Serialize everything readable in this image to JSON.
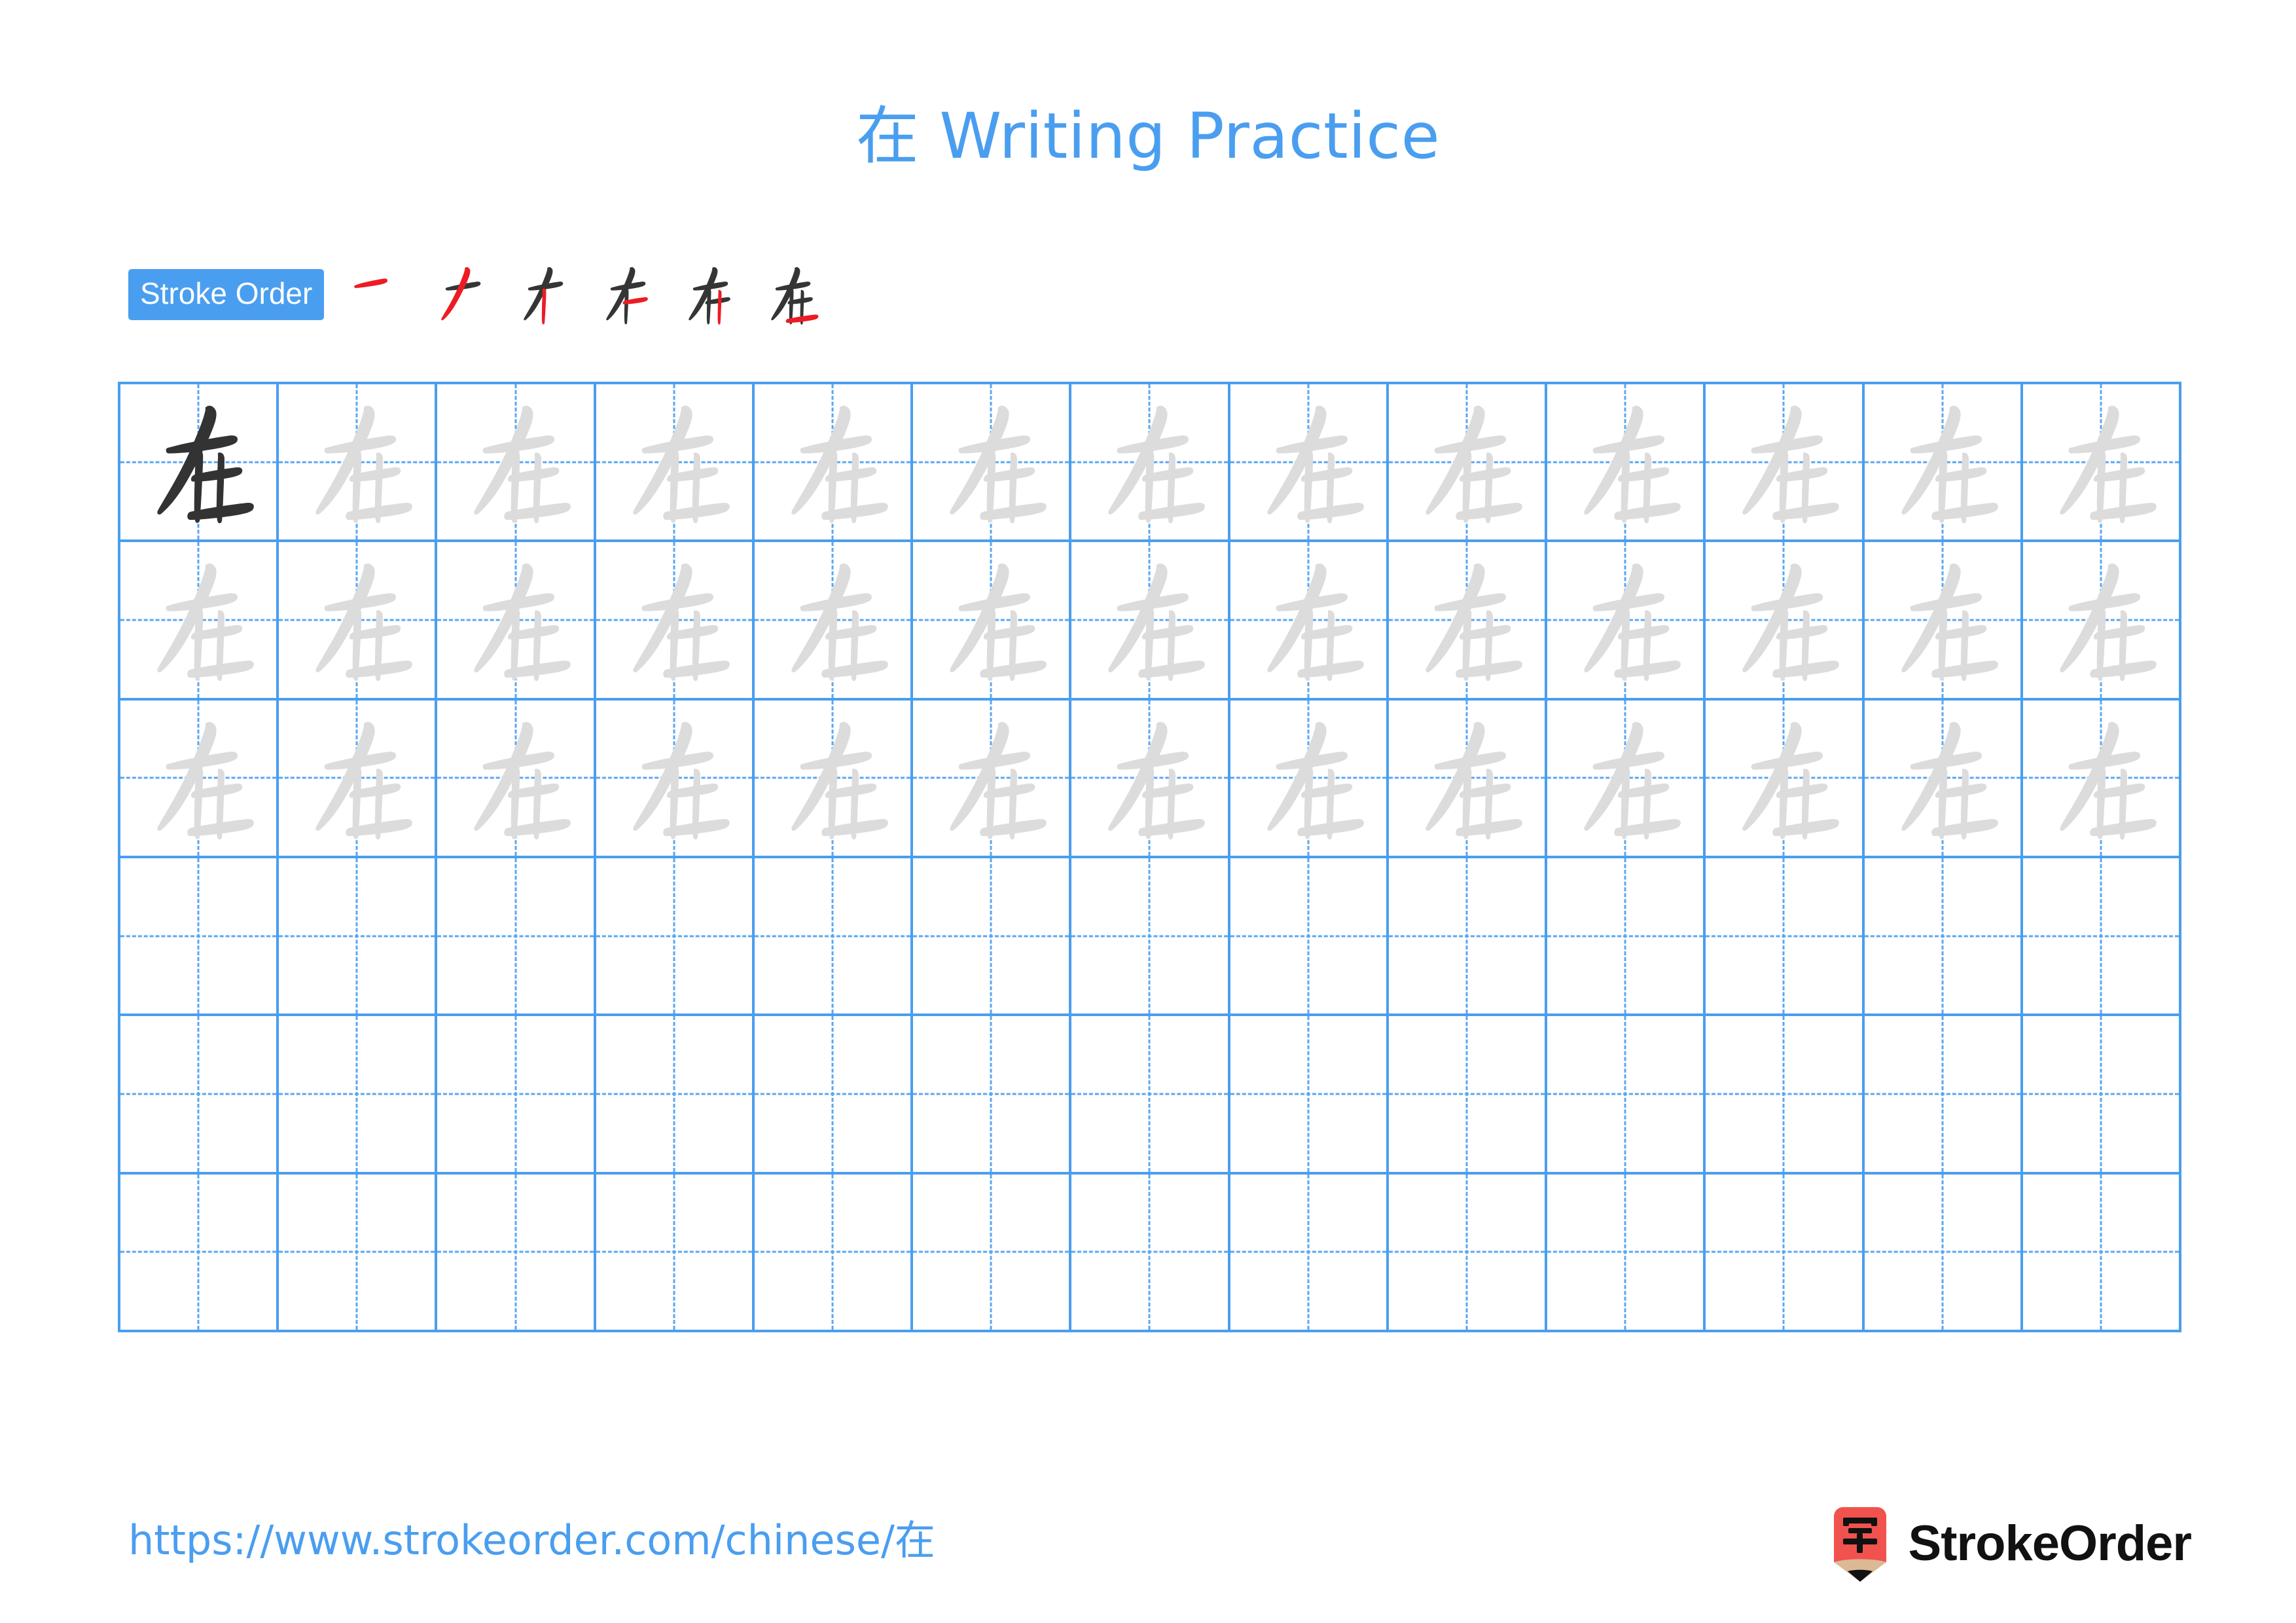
{
  "document": {
    "character": "在",
    "title": "在 Writing Practice",
    "title_color": "#4a9eef",
    "background_color": "#ffffff"
  },
  "stroke_order": {
    "badge_label": "Stroke Order",
    "badge_background": "#4a9eef",
    "badge_text_color": "#ffffff",
    "stroke_count": 6,
    "previous_stroke_color": "#353535",
    "new_stroke_color": "#ed1c24",
    "steps": [
      {
        "index": 1,
        "name": "stroke-step-1",
        "strokes_shown": 1,
        "new_stroke": "héng (horizontal)"
      },
      {
        "index": 2,
        "name": "stroke-step-2",
        "strokes_shown": 2,
        "new_stroke": "piě (left-falling)"
      },
      {
        "index": 3,
        "name": "stroke-step-3",
        "strokes_shown": 3,
        "new_stroke": "shù (vertical)"
      },
      {
        "index": 4,
        "name": "stroke-step-4",
        "strokes_shown": 4,
        "new_stroke": "héng (horizontal)"
      },
      {
        "index": 5,
        "name": "stroke-step-5",
        "strokes_shown": 5,
        "new_stroke": "shù (vertical)"
      },
      {
        "index": 6,
        "name": "stroke-step-6",
        "strokes_shown": 6,
        "new_stroke": "héng (bottom horizontal)"
      }
    ]
  },
  "practice_grid": {
    "columns": 13,
    "rows": 6,
    "grid_line_color": "#4a9eef",
    "guide_line_color": "#5aa7f0",
    "model_character_color": "#333333",
    "trace_character_color": "#dcdcdc",
    "cells": [
      [
        "model",
        "trace",
        "trace",
        "trace",
        "trace",
        "trace",
        "trace",
        "trace",
        "trace",
        "trace",
        "trace",
        "trace",
        "trace"
      ],
      [
        "trace",
        "trace",
        "trace",
        "trace",
        "trace",
        "trace",
        "trace",
        "trace",
        "trace",
        "trace",
        "trace",
        "trace",
        "trace"
      ],
      [
        "trace",
        "trace",
        "trace",
        "trace",
        "trace",
        "trace",
        "trace",
        "trace",
        "trace",
        "trace",
        "trace",
        "trace",
        "trace"
      ],
      [
        "empty",
        "empty",
        "empty",
        "empty",
        "empty",
        "empty",
        "empty",
        "empty",
        "empty",
        "empty",
        "empty",
        "empty",
        "empty"
      ],
      [
        "empty",
        "empty",
        "empty",
        "empty",
        "empty",
        "empty",
        "empty",
        "empty",
        "empty",
        "empty",
        "empty",
        "empty",
        "empty"
      ],
      [
        "empty",
        "empty",
        "empty",
        "empty",
        "empty",
        "empty",
        "empty",
        "empty",
        "empty",
        "empty",
        "empty",
        "empty",
        "empty"
      ]
    ]
  },
  "footer": {
    "url": "https://www.strokeorder.com/chinese/在",
    "url_color": "#4a9eef",
    "brand_name": "StrokeOrder",
    "brand_mark_character": "字",
    "brand_mark_body_color": "#f1524e",
    "brand_mark_wood_color": "#dbb994",
    "brand_mark_tip_color": "#111111"
  }
}
